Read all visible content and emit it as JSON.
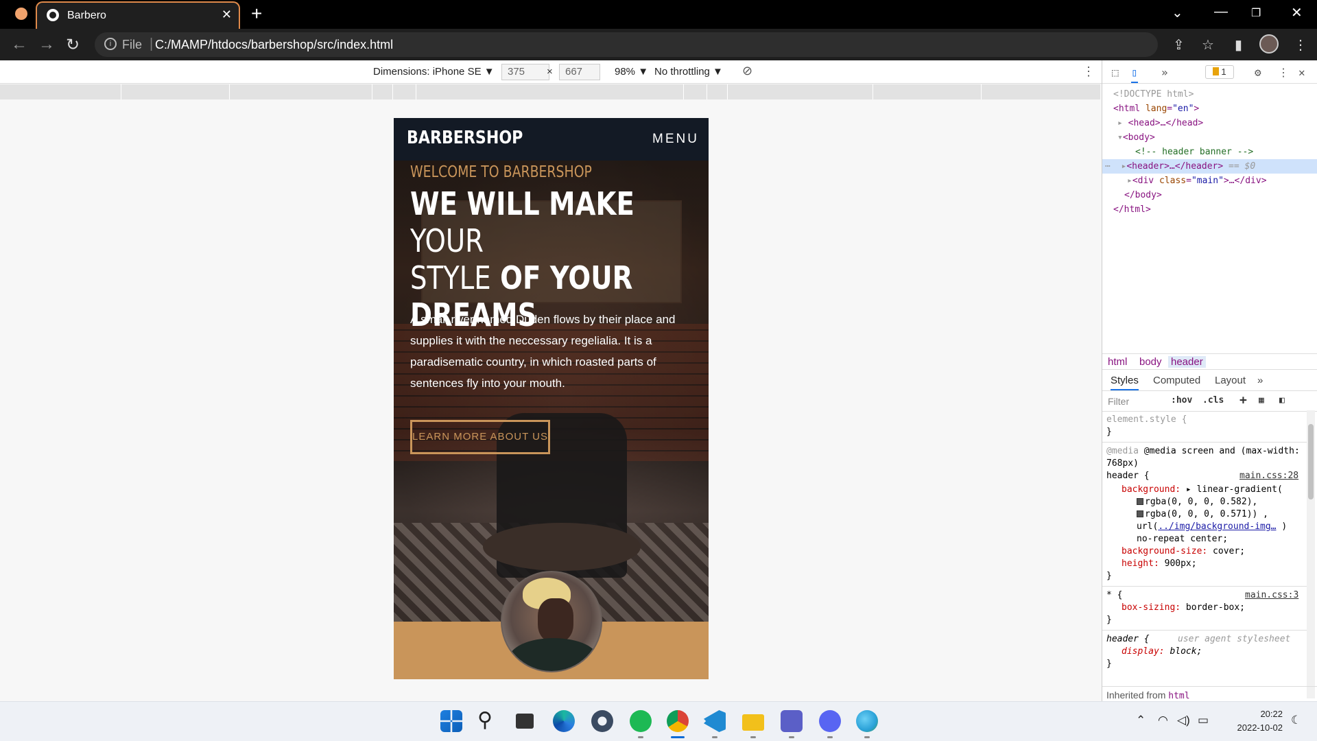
{
  "browser": {
    "tab_title": "Barbero",
    "tab_close": "✕",
    "new_tab": "+",
    "address_scheme": "File",
    "address_url": "C:/MAMP/htdocs/barbershop/src/index.html"
  },
  "device_toolbar": {
    "dimensions_label": "Dimensions: iPhone SE ▼",
    "width": "375",
    "times": "×",
    "height": "667",
    "zoom": "98% ▼",
    "throttling": "No throttling ▼"
  },
  "site": {
    "brand": "BARBERSHOP",
    "menu": "MENU",
    "welcome": "WELCOME TO BARBERSHOP",
    "headline_bold1": "WE WILL MAKE",
    "headline_thin1": " YOUR",
    "headline_thin2": "STYLE",
    "headline_bold2": " OF YOUR",
    "headline_bold3": "DREAMS",
    "paragraph": "A small river named Duden flows by their place and supplies it with the neccessary regelialia. It is a paradisematic country, in which roasted parts of sentences fly into your mouth.",
    "cta": "LEARN MORE ABOUT US"
  },
  "devtools": {
    "issues_count": "1",
    "dom": {
      "doctype": "<!DOCTYPE html>",
      "html_open_tag": "<html",
      "html_attr": "lang",
      "html_attr_val": "\"en\"",
      "head": "<head>…</head>",
      "body_open": "<body>",
      "comment": "<!-- header banner -->",
      "header": "<header>…</header>",
      "header_sel": "== $0",
      "div_open": "<div",
      "div_attr": "class",
      "div_attr_val": "\"main\"",
      "div_close": ">…</div>",
      "body_close": "</body>",
      "html_close": "</html>"
    },
    "breadcrumbs": [
      "html",
      "body",
      "header"
    ],
    "tabs": [
      "Styles",
      "Computed",
      "Layout",
      "»"
    ],
    "filter_placeholder": "Filter",
    "hov": ":hov",
    "cls": ".cls",
    "styles": {
      "element_style": "element.style {",
      "close": "}",
      "media1": "@media screen and (max-width:",
      "media2": "768px)",
      "header_sel": "header {",
      "main_css_28": "main.css:28",
      "bg_prop": "background:",
      "bg_val": " ▸ linear-gradient(",
      "rgba1": "rgba(0, 0, 0, 0.582),",
      "rgba2": "rgba(0, 0, 0, 0.571)) ,",
      "url_fn": "url(",
      "url_link": "../img/background-img…",
      "url_close": " )",
      "no_repeat": "no-repeat center;",
      "bgsize_prop": "background-size:",
      "bgsize_val": " cover;",
      "height_prop": "height:",
      "height_val": " 900px;",
      "star_sel": "* {",
      "main_css_3": "main.css:3",
      "boxsizing_prop": "box-sizing:",
      "boxsizing_val": " border-box;",
      "header_ua": "header {",
      "ua_label": "user agent stylesheet",
      "display_prop": "display:",
      "display_val": " block;",
      "inherited": "Inherited from",
      "inherited_tag": "html"
    }
  },
  "taskbar": {
    "time": "20:22",
    "date": "2022-10-02",
    "apps": [
      "start-icon",
      "search-icon",
      "task-view-icon",
      "edge-icon",
      "settings-icon",
      "spotify-icon",
      "chrome-icon",
      "vscode-icon",
      "file-explorer-icon",
      "teams-icon",
      "discord-icon",
      "globe-app-icon"
    ]
  },
  "colors": {
    "accent": "#c9955a",
    "site_header": "#131a25",
    "tab_border": "#e08a4a"
  }
}
